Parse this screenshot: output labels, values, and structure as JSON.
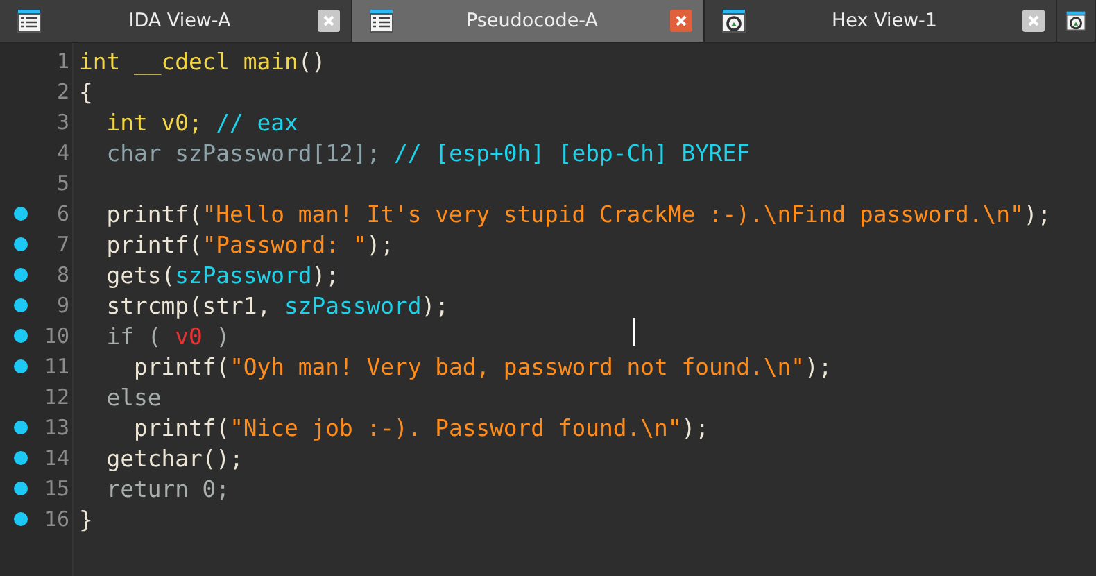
{
  "tabs": [
    {
      "label": "IDA View-A",
      "kind": "listing",
      "selected": false
    },
    {
      "label": "Pseudocode-A",
      "kind": "listing",
      "selected": true
    },
    {
      "label": "Hex View-1",
      "kind": "hex",
      "selected": false
    }
  ],
  "code": {
    "lines": [
      {
        "number": "1",
        "breakpoint": false,
        "tokens": [
          {
            "kind": "decl",
            "text": "int __cdecl main"
          },
          {
            "kind": "plain",
            "text": "()"
          }
        ]
      },
      {
        "number": "2",
        "breakpoint": false,
        "tokens": [
          {
            "kind": "plain",
            "text": "{"
          }
        ]
      },
      {
        "number": "3",
        "breakpoint": false,
        "tokens": [
          {
            "kind": "decl",
            "text": "  int v0; "
          },
          {
            "kind": "comment",
            "text": "// eax"
          }
        ]
      },
      {
        "number": "4",
        "breakpoint": false,
        "tokens": [
          {
            "kind": "dim",
            "text": "  char szPassword[12]; "
          },
          {
            "kind": "comment",
            "text": "// [esp+0h] [ebp-Ch] BYREF"
          }
        ]
      },
      {
        "number": "5",
        "breakpoint": false
      },
      {
        "number": "6",
        "breakpoint": true,
        "tokens": [
          {
            "kind": "plain",
            "text": "  printf("
          },
          {
            "kind": "string",
            "text": "\"Hello man! It's very stupid CrackMe :-).\\nFind password.\\n\""
          },
          {
            "kind": "plain",
            "text": ");"
          }
        ]
      },
      {
        "number": "7",
        "breakpoint": true,
        "tokens": [
          {
            "kind": "plain",
            "text": "  printf("
          },
          {
            "kind": "string",
            "text": "\"Password: \""
          },
          {
            "kind": "plain",
            "text": ");"
          }
        ]
      },
      {
        "number": "8",
        "breakpoint": true,
        "tokens": [
          {
            "kind": "plain",
            "text": "  gets("
          },
          {
            "kind": "var",
            "text": "szPassword"
          },
          {
            "kind": "plain",
            "text": ");"
          }
        ]
      },
      {
        "number": "9",
        "breakpoint": true,
        "tokens": [
          {
            "kind": "plain",
            "text": "  strcmp(str1, "
          },
          {
            "kind": "var",
            "text": "szPassword"
          },
          {
            "kind": "plain",
            "text": ");"
          }
        ]
      },
      {
        "number": "10",
        "breakpoint": true,
        "tokens": [
          {
            "kind": "muted",
            "text": "  if ( "
          },
          {
            "kind": "highlight",
            "text": "v0"
          },
          {
            "kind": "muted",
            "text": " )"
          }
        ]
      },
      {
        "number": "11",
        "breakpoint": true,
        "tokens": [
          {
            "kind": "plain",
            "text": "    printf("
          },
          {
            "kind": "string",
            "text": "\"Oyh man! Very bad, password not found.\\n\""
          },
          {
            "kind": "plain",
            "text": ");"
          }
        ]
      },
      {
        "number": "12",
        "breakpoint": false,
        "tokens": [
          {
            "kind": "muted",
            "text": "  else"
          }
        ]
      },
      {
        "number": "13",
        "breakpoint": true,
        "tokens": [
          {
            "kind": "plain",
            "text": "    printf("
          },
          {
            "kind": "string",
            "text": "\"Nice job :-). Password found.\\n\""
          },
          {
            "kind": "plain",
            "text": ");"
          }
        ]
      },
      {
        "number": "14",
        "breakpoint": true,
        "tokens": [
          {
            "kind": "plain",
            "text": "  getchar();"
          }
        ]
      },
      {
        "number": "15",
        "breakpoint": true,
        "tokens": [
          {
            "kind": "muted",
            "text": "  return 0;"
          }
        ]
      },
      {
        "number": "16",
        "breakpoint": true,
        "tokens": [
          {
            "kind": "plain",
            "text": "}"
          }
        ]
      }
    ]
  }
}
